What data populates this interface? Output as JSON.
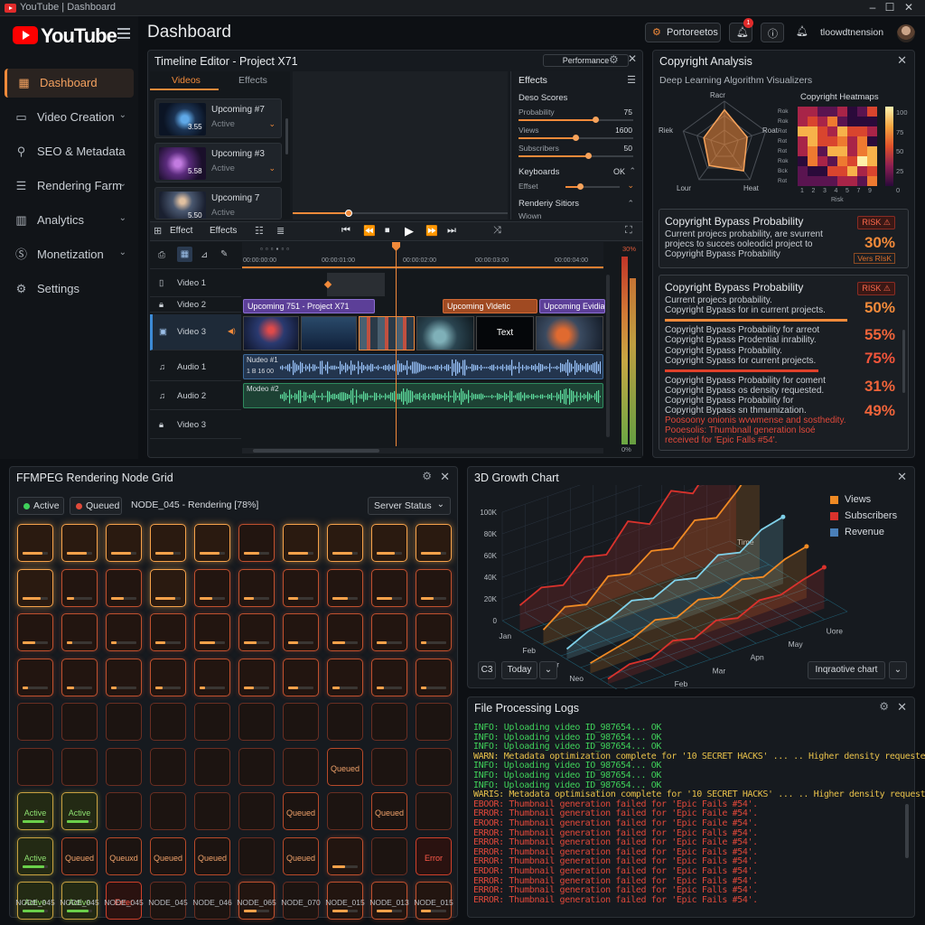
{
  "window": {
    "title": "YouTube | Dashboard"
  },
  "sidebar": {
    "brand": "YouTube",
    "items": [
      {
        "label": "Dashboard",
        "icon": "grid-icon",
        "active": true
      },
      {
        "label": "Video Creation",
        "icon": "video-icon"
      },
      {
        "label": "SEO & Metadata",
        "icon": "search-icon"
      },
      {
        "label": "Rendering Farm",
        "icon": "server-icon"
      },
      {
        "label": "Analytics",
        "icon": "bar-chart-icon"
      },
      {
        "label": "Monetization",
        "icon": "dollar-icon"
      },
      {
        "label": "Settings",
        "icon": "gear-icon"
      }
    ]
  },
  "header": {
    "title": "Dashboard",
    "project_button": "Portoreetos",
    "notification_count": "1",
    "user_name": "tloowdtnension"
  },
  "timeline": {
    "title": "Timeline Editor - Project X71",
    "performance": "Performance",
    "tabs": [
      "Videos",
      "Effects"
    ],
    "thumbs": [
      {
        "title": "Upcoming #7",
        "status": "Active",
        "dur": "3.55"
      },
      {
        "title": "Upcoming #3",
        "status": "Active",
        "dur": "5.58"
      },
      {
        "title": "Upcoming 7",
        "status": "Active",
        "dur": "5.50"
      }
    ],
    "effects": {
      "title": "Effects",
      "group": "Deso Scores",
      "rows": [
        {
          "label": "Probability",
          "value": "75",
          "level": 0.68
        },
        {
          "label": "Views",
          "value": "1600",
          "level": 0.5
        },
        {
          "label": "Subscribers",
          "value": "50",
          "level": 0.62
        }
      ],
      "keyboards": "Keyboards",
      "keyboards_val": "OK",
      "effect": "Effset",
      "render": "Renderiy Sitiors",
      "render_sub": "Wiown"
    },
    "toolbar": {
      "effect1": "Effect",
      "effect2": "Effects"
    },
    "timecodes": [
      "00:00:00:00",
      "00:00:01:00",
      "00:00:02:00",
      "00:00:03:00",
      "00:00:04:00",
      "00:00:05:00"
    ],
    "tracks": [
      "Video 1",
      "Video 2",
      "Video 3",
      "Audio 1",
      "Audio 2",
      "Video 3"
    ],
    "clips": {
      "v2a": "Upcoming 751 - Project X71",
      "v2b": "Upcoming Vldetic",
      "v2c": "Upcoming Evidia",
      "text": "Text",
      "a1": "Nudeo #1",
      "a1b": "1 B 16 00",
      "a2": "Modeo #2"
    },
    "meter_top": "30%",
    "meter_bot": "0%"
  },
  "copyright": {
    "title": "Copyright Analysis",
    "subtitle": "Deep Learning Algorithm Visualizers",
    "radar_labels": [
      "Racr",
      "Roat",
      "Heat",
      "Lour",
      "Riek"
    ],
    "heatmap_title": "Copyright Heatmaps",
    "heatmap_scale": [
      "100",
      "75",
      "50",
      "25",
      "0"
    ],
    "heatmap_x": [
      "1",
      "2",
      "3",
      "4",
      "5",
      "7",
      "9"
    ],
    "heatmap_y": [
      "Rok",
      "Rok",
      "Rot",
      "Rot",
      "Rot",
      "Rok",
      "Bck",
      "Rot"
    ],
    "heatmap_xlabel": "Risk",
    "card1": {
      "title": "Copyright Bypass Probability",
      "risk": "RISK",
      "lines": [
        "Current projecs probability, are svurrent",
        "projecs to succes ooleodicl project to",
        "Copyright Bypass Probability"
      ],
      "pct": "30%",
      "tag": "Vers RIsK"
    },
    "card2": {
      "title": "Copyright Bypass Probability",
      "risk": "RISK",
      "rows": [
        {
          "lines": [
            "Current projecs probability.",
            "Copyright Bypass for in current projects."
          ],
          "pct": "50%"
        },
        {
          "lines": [
            "Copyright Bypass Probability for arreot",
            "Copyright Bypass Prodential inrability."
          ],
          "pct": "55%"
        },
        {
          "lines": [
            "Copyright Bypass Probability.",
            "Copyright Sypass for current projects."
          ],
          "pct": "75%"
        },
        {
          "lines": [
            "Copyright Bypass Probability for coment",
            "Copyright Bypass os density requested."
          ],
          "pct": "31%"
        },
        {
          "lines": [
            "Copyright Bypass Probability for",
            "Copyright Bypass sn thmumization."
          ],
          "pct": "49%"
        }
      ],
      "warn": [
        "Poosoony onionis wvwmense and sosthedity.",
        "Pooesolis: Thumbnall generation lsoé",
        "received for 'Epic Falls #54'."
      ]
    }
  },
  "ffmpeg": {
    "title": "FFMPEG Rendering Node Grid",
    "active": "Active",
    "queued": "Queued",
    "current": "NODE_045 - Rendering [78%]",
    "server": "Server Status",
    "node_labels": [
      "NODE_045",
      "NODE_045",
      "NODE_045",
      "NODE_045",
      "NODE_046",
      "NODE_065",
      "NODE_070",
      "NODE_015",
      "NODE_013",
      "NODE_015"
    ],
    "cells": [
      [
        "b:0.8",
        "b:0.8",
        "b:0.8",
        "b:0.7",
        "b:0.8",
        "b:0.6",
        "b:0.8",
        "b:0.8",
        "b:0.7",
        "b:0.8"
      ],
      [
        "b:0.7",
        "b:0.3",
        "b:0.5",
        "b:0.8",
        "b:0.5",
        "b:0.4",
        "b:0.4",
        "b:0.6",
        "b:0.6",
        "b:0.5"
      ],
      [
        "b:0.5",
        "b:0.2",
        "b:0.2",
        "b:0.4",
        "b:0.6",
        "b:0.5",
        "b:0.4",
        "b:0.5",
        "b:0.4",
        "b:0.2"
      ],
      [
        "b:0.2",
        "b:0.3",
        "b:0.2",
        "b:0.3",
        "b:0.2",
        "b:0.4",
        "b:0.4",
        "b:0.3",
        "b:0.3",
        "b:0.2"
      ],
      [
        "",
        "",
        "",
        "",
        "",
        "",
        "",
        "",
        "",
        ""
      ],
      [
        "",
        "",
        "",
        "",
        "",
        "",
        "",
        "t:Queued",
        "",
        ""
      ],
      [
        "t:Active",
        "t:Active",
        "",
        "",
        "",
        "",
        "t:Queued",
        "",
        "t:Queued",
        ""
      ],
      [
        "t:Active",
        "t:Queued",
        "t:Queuxd",
        "t:Queued",
        "t:Queued",
        "",
        "t:Queued",
        "b:0.5",
        "",
        "t:Error"
      ],
      [
        "t:Active",
        "t:Active",
        "t:Errer",
        "",
        "",
        "b:0.5",
        "",
        "b:0.6",
        "b:0.6",
        "b:0.4"
      ]
    ]
  },
  "growth": {
    "title": "3D Growth Chart",
    "legend": [
      {
        "name": "Views",
        "color": "#f08a24"
      },
      {
        "name": "Subscribers",
        "color": "#d9322c"
      },
      {
        "name": "Revenue",
        "color": "#4a7fb8"
      }
    ],
    "y_ticks": [
      "100K",
      "80K",
      "60K",
      "40K",
      "20K",
      "0"
    ],
    "x_front": [
      "Jan",
      "Feb",
      "Mer",
      "Neo",
      "Dec"
    ],
    "x_right": [
      "Jan",
      "Feb",
      "Mar",
      "Apn",
      "May",
      "Uore"
    ],
    "z_label": "Time",
    "controls": {
      "c3": "C3",
      "today": "Today",
      "chart": "Inqraotive chart"
    }
  },
  "logs": {
    "title": "File Processing Logs",
    "lines": [
      {
        "t": "INFO: Uploading video ID_987654... ",
        "ok": "OK",
        "c": "#3fd05a"
      },
      {
        "t": "INFO: Uploading video ID_987654... ",
        "ok": "OK",
        "c": "#3fd05a"
      },
      {
        "t": "INFO: Uploading video ID_987654... ",
        "ok": "OK",
        "c": "#3fd05a"
      },
      {
        "t": "WARN: Metadata optimization complete for '10 SECRET HACKS' ... .. Higher density requested",
        "ok": "",
        "c": "#e8c14a"
      },
      {
        "t": "INFO: Uploading video IO_987654... ",
        "ok": "OK",
        "c": "#3fd05a"
      },
      {
        "t": "INFO: Uploading video ID_987654... ",
        "ok": "OK",
        "c": "#3fd05a"
      },
      {
        "t": "INFO: Uploading video ID_987654... ",
        "ok": "OK",
        "c": "#3fd05a"
      },
      {
        "t": "WARIS: Metadata optimisation complete for '10 SECRET HACKS' ... .. Higher density requested",
        "ok": "",
        "c": "#e8c14a"
      },
      {
        "t": "EBOOR: Thumbnail generation failed for 'Epic Fails #54'.",
        "ok": "",
        "c": "#e0483a"
      },
      {
        "t": "ERROR: Thumbnail generation failed for 'Epic Faile #54'.",
        "ok": "",
        "c": "#e0483a"
      },
      {
        "t": "EROOR: Thumbnail generation failed for 'Epic Faile #54'.",
        "ok": "",
        "c": "#e0483a"
      },
      {
        "t": "ERROR: Thumbnail generation failed for 'Epic Falls #54'.",
        "ok": "",
        "c": "#e0483a"
      },
      {
        "t": "ERROR: Thumbnail generation failed for 'Epic Faile #54'.",
        "ok": "",
        "c": "#e0483a"
      },
      {
        "t": "ERROR: Thumbnail generation failed for 'Epic Fails #54'.",
        "ok": "",
        "c": "#e0483a"
      },
      {
        "t": "ERROR: Thumbnail generation failed for 'Epic Fails #54'.",
        "ok": "",
        "c": "#e0483a"
      },
      {
        "t": "ERDOR: Thumbnail generation failed for 'Epic Fails #54'.",
        "ok": "",
        "c": "#e0483a"
      },
      {
        "t": "ERROR: Thumbnail generation failed for 'Epic Fails #54'.",
        "ok": "",
        "c": "#e0483a"
      },
      {
        "t": "ERROR: Thumbnail generation failed for 'Epic Falls #54'.",
        "ok": "",
        "c": "#e0483a"
      },
      {
        "t": "ERROR: Thumbnail generation failed for 'Epic Fails #54'.",
        "ok": "",
        "c": "#e0483a"
      }
    ]
  }
}
